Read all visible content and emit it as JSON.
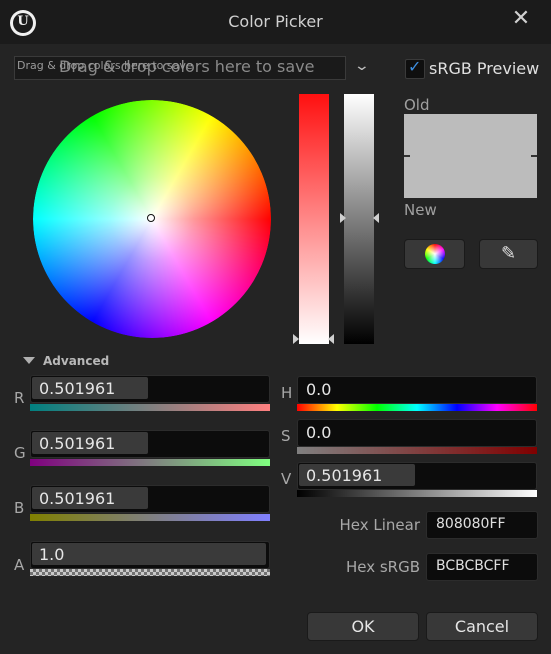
{
  "window": {
    "title": "Color Picker",
    "close_glyph": "✕",
    "logo_glyph": "U"
  },
  "dropzone": {
    "placeholder_small": "Drag & drop colors here to save",
    "placeholder": "Drag & drop colors here to save",
    "chevron_glyph": "⌄"
  },
  "srgb_preview": {
    "label": "sRGB Preview",
    "checked": true,
    "check_glyph": "✓"
  },
  "preview": {
    "old_label": "Old",
    "new_label": "New",
    "old_color": "#bcbcbc",
    "new_color": "#bcbcbc"
  },
  "tools": {
    "wheel_icon": "color-wheel-icon",
    "dropper_icon": "eyedropper-icon",
    "dropper_glyph": "✎"
  },
  "advanced": {
    "label": "Advanced"
  },
  "rgba": {
    "r": {
      "label": "R",
      "value": "0.501961"
    },
    "g": {
      "label": "G",
      "value": "0.501961"
    },
    "b": {
      "label": "B",
      "value": "0.501961"
    },
    "a": {
      "label": "A",
      "value": "1.0"
    }
  },
  "hsv": {
    "h": {
      "label": "H",
      "value": "0.0"
    },
    "s": {
      "label": "S",
      "value": "0.0"
    },
    "v": {
      "label": "V",
      "value": "0.501961"
    }
  },
  "hex": {
    "linear_label": "Hex Linear",
    "linear_value": "808080FF",
    "srgb_label": "Hex sRGB",
    "srgb_value": "BCBCBCFF"
  },
  "buttons": {
    "ok": "OK",
    "cancel": "Cancel"
  },
  "colors": {
    "accent": "#3d8ee0",
    "background": "#242424",
    "field": "#0c0c0c"
  }
}
